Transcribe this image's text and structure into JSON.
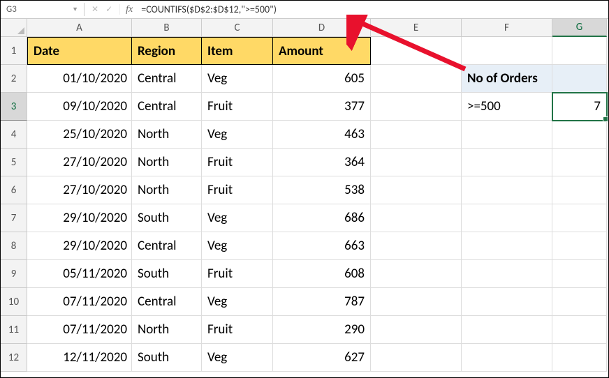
{
  "name_box": "G3",
  "formula": "=COUNTIFS($D$2:$D$12,\">=500\")",
  "columns": [
    "A",
    "B",
    "C",
    "D",
    "E",
    "F",
    "G"
  ],
  "rows": [
    "1",
    "2",
    "3",
    "4",
    "5",
    "6",
    "7",
    "8",
    "9",
    "10",
    "11",
    "12"
  ],
  "headers": {
    "A": "Date",
    "B": "Region",
    "C": "Item",
    "D": "Amount"
  },
  "data": [
    {
      "date": "01/10/2020",
      "region": "Central",
      "item": "Veg",
      "amount": "605"
    },
    {
      "date": "09/10/2020",
      "region": "Central",
      "item": "Fruit",
      "amount": "377"
    },
    {
      "date": "25/10/2020",
      "region": "North",
      "item": "Veg",
      "amount": "463"
    },
    {
      "date": "27/10/2020",
      "region": "North",
      "item": "Fruit",
      "amount": "364"
    },
    {
      "date": "27/10/2020",
      "region": "North",
      "item": "Fruit",
      "amount": "538"
    },
    {
      "date": "29/10/2020",
      "region": "South",
      "item": "Veg",
      "amount": "686"
    },
    {
      "date": "29/10/2020",
      "region": "Central",
      "item": "Veg",
      "amount": "663"
    },
    {
      "date": "05/11/2020",
      "region": "South",
      "item": "Fruit",
      "amount": "608"
    },
    {
      "date": "07/11/2020",
      "region": "Central",
      "item": "Veg",
      "amount": "787"
    },
    {
      "date": "07/11/2020",
      "region": "North",
      "item": "Fruit",
      "amount": "290"
    },
    {
      "date": "12/11/2020",
      "region": "South",
      "item": "Veg",
      "amount": "627"
    }
  ],
  "side": {
    "title": "No of Orders",
    "criteria": ">=500",
    "result": "7"
  }
}
